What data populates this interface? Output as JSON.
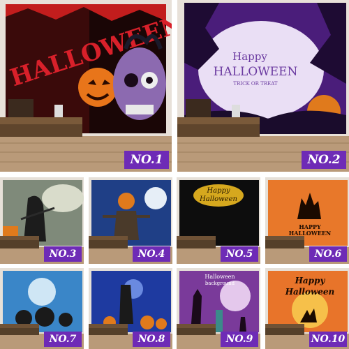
{
  "products": [
    {
      "badge": "NO.1",
      "art_text": "HALLOWEEN"
    },
    {
      "badge": "NO.2",
      "art_title_1": "Happy",
      "art_title_2": "HALLOWEEN",
      "art_subtitle": "TRICK OR TREAT"
    },
    {
      "badge": "NO.3"
    },
    {
      "badge": "NO.4"
    },
    {
      "badge": "NO.5",
      "art_title_1": "Happy",
      "art_title_2": "Halloween"
    },
    {
      "badge": "NO.6",
      "art_title_1": "HAPPY",
      "art_title_2": "HALLOWEEN"
    },
    {
      "badge": "NO.7"
    },
    {
      "badge": "NO.8"
    },
    {
      "badge": "NO.9",
      "art_title_1": "Halloween",
      "art_title_2": "background"
    },
    {
      "badge": "NO.10",
      "art_title_1": "Happy",
      "art_title_2": "Halloween"
    }
  ],
  "colors": {
    "badge_bg": "#6e2bb6",
    "badge_text": "#ffffff",
    "floor": "#b99a79"
  }
}
